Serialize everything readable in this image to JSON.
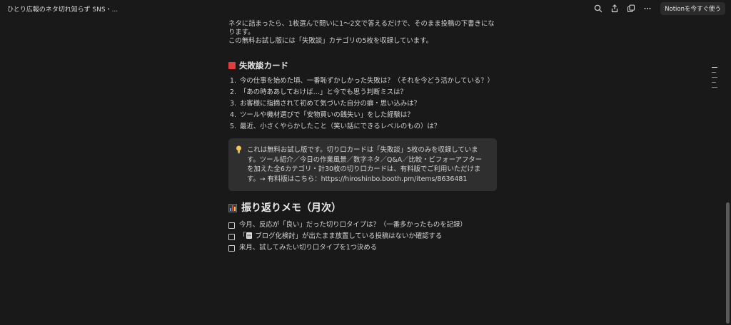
{
  "app": {
    "tab_title": "ひとり広報のネタ切れ知らず SNS・...",
    "cta_label": "Notionを今すぐ使う"
  },
  "intro": {
    "line1": "ネタに詰まったら、1枚選んで問いに1〜2文で答えるだけで、そのまま投稿の下書きになります。",
    "line2": "この無料お試し版には「失敗談」カテゴリの5枚を収録しています。"
  },
  "failure_section": {
    "title": "失敗談カード",
    "items": [
      {
        "num": "1.",
        "text": "今の仕事を始めた頃、一番恥ずかしかった失敗は？（それを今どう活かしている？）"
      },
      {
        "num": "2.",
        "text": "「あの時ああしておけば…」と今でも思う判断ミスは？"
      },
      {
        "num": "3.",
        "text": "お客様に指摘されて初めて気づいた自分の癖・思い込みは？"
      },
      {
        "num": "4.",
        "text": "ツールや機材選びで「安物買いの銭失い」をした経験は？"
      },
      {
        "num": "5.",
        "text": "最近、小さくやらかしたこと（笑い話にできるレベルのもの）は？"
      }
    ]
  },
  "callout": {
    "text": "これは無料お試し版です。切り口カードは「失敗談」5枚のみを収録しています。ツール紹介／今日の作業風景／数字ネタ／Q&A／比較・ビフォーアフターを加えた全6カテゴリ・計30枚の切り口カードは、有料版でご利用いただけます。→ 有料版はこちら：https://hiroshinbo.booth.pm/items/8636481",
    "icon": "lightbulb-icon"
  },
  "memo_section": {
    "title": "振り返りメモ（月次）",
    "todos": [
      {
        "before": "今月、反応が「良い」だった切り口タイプは？（一番多かったものを記録）",
        "after": ""
      },
      {
        "before": "「",
        "after": " ブログ化検討」が出たまま放置している投稿はないか確認する"
      },
      {
        "before": "来月、試してみたい切り口タイプを1つ決める",
        "after": ""
      }
    ]
  },
  "colors": {
    "background": "#191919",
    "callout_bg": "#2f2f2f",
    "red_square": "#e03e3e"
  }
}
